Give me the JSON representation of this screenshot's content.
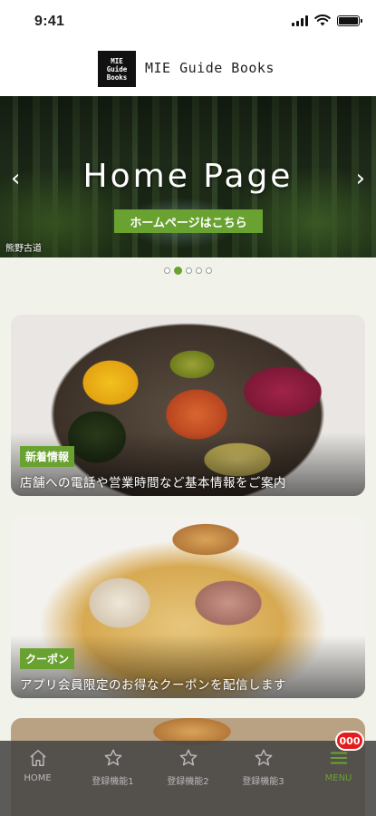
{
  "status_bar": {
    "time": "9:41"
  },
  "header": {
    "logo_lines": [
      "MIE",
      "Guide",
      "Books"
    ],
    "title": "MIE Guide Books"
  },
  "hero": {
    "title": "Home Page",
    "button_label": "ホームページはこちら",
    "caption": "熊野古道",
    "slide_count": 5,
    "active_slide": 2
  },
  "cards": [
    {
      "tag": "新着情報",
      "description": "店舗への電話や営業時間など基本情報をご案内"
    },
    {
      "tag": "クーポン",
      "description": "アプリ会員限定のお得なクーポンを配信します"
    }
  ],
  "tabbar": {
    "items": [
      {
        "label": "HOME",
        "icon": "home-icon"
      },
      {
        "label": "登録機能1",
        "icon": "star-icon"
      },
      {
        "label": "登録機能2",
        "icon": "star-icon"
      },
      {
        "label": "登録機能3",
        "icon": "star-icon"
      },
      {
        "label": "MENU",
        "icon": "menu-icon"
      }
    ],
    "badge": "000"
  },
  "colors": {
    "accent": "#6aa231",
    "badge": "#e31d1d",
    "tabbar": "#464646"
  }
}
